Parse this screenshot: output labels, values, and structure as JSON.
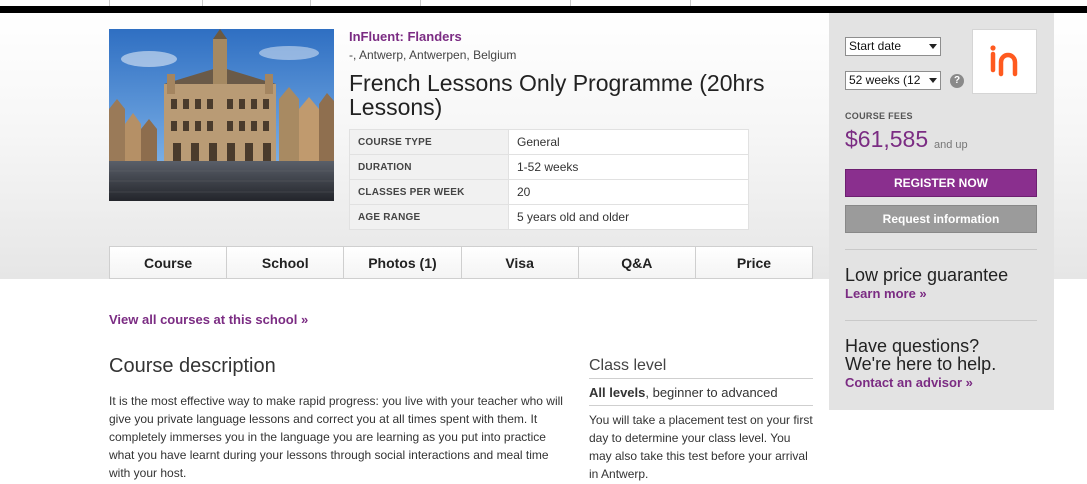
{
  "school": {
    "name": "InFluent: Flanders",
    "location": "-, Antwerp, Antwerpen, Belgium"
  },
  "course": {
    "title": "French Lessons Only Programme (20hrs Lessons)"
  },
  "facts": [
    {
      "key": "COURSE TYPE",
      "value": "General"
    },
    {
      "key": "DURATION",
      "value": "1-52 weeks"
    },
    {
      "key": "CLASSES PER WEEK",
      "value": "20"
    },
    {
      "key": "AGE RANGE",
      "value": "5 years old and older"
    }
  ],
  "tabs": [
    "Course",
    "School",
    "Photos (1)",
    "Visa",
    "Q&A",
    "Price"
  ],
  "links": {
    "view_all": "View all courses at this school »"
  },
  "description": {
    "heading": "Course description",
    "text": "It is the most effective way to make rapid progress: you live with your teacher who will give you private language lessons and correct you at all times spent with them. It completely immerses you in the language you are learning as you put into practice what you have learnt during your lessons through social interactions and meal time with your host."
  },
  "class_level": {
    "heading": "Class level",
    "summary_bold": "All levels",
    "summary_rest": ", beginner to advanced",
    "text": "You will take a placement test on your first day to determine your class level. You may also take this test before your arrival in Antwerp."
  },
  "sidebar": {
    "start_date_select": "Start date",
    "weeks_select": "52 weeks (12",
    "help_glyph": "?",
    "fees_label": "COURSE FEES",
    "fees_amount": "$61,585",
    "fees_suffix": "and up",
    "register_label": "REGISTER NOW",
    "request_label": "Request information",
    "guarantee_heading": "Low price guarantee",
    "learn_more": "Learn more »",
    "questions_line1": "Have questions?",
    "questions_line2": "We're here to help.",
    "contact_link": "Contact an advisor »"
  },
  "colors": {
    "brand_purple": "#7b2c83",
    "register_bg": "#8a2f8e",
    "request_bg": "#9b9b9b",
    "logo_orange": "#ff5a1f"
  },
  "icons": {
    "school_logo": "influent-logo-icon",
    "help": "question-circle-icon",
    "dropdown": "chevron-down-icon"
  }
}
